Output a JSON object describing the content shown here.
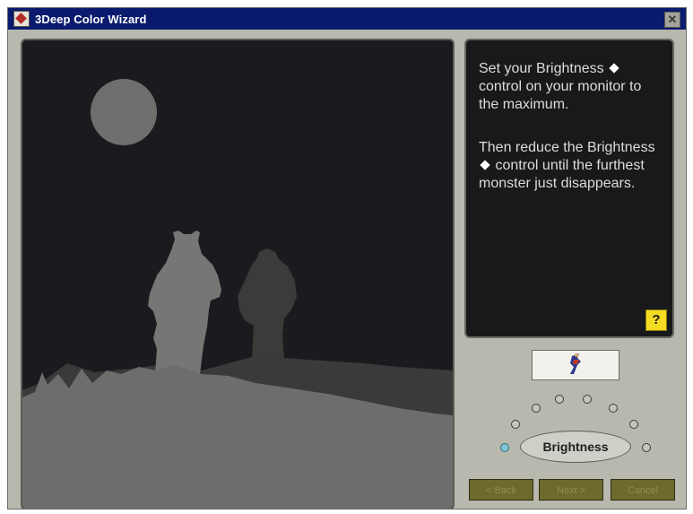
{
  "window": {
    "title": "3Deep Color Wizard",
    "close_glyph": "✕"
  },
  "instructions": {
    "para1_before": "Set your Brightness",
    "para1_after": "control on your monitor to the maximum.",
    "para2_before": "Then reduce the Brightness",
    "para2_after": "control until the furthest monster just disappears.",
    "help_label": "?"
  },
  "control": {
    "label": "Brightness"
  },
  "buttons": {
    "back_label": "< Back",
    "next_label": "Next >",
    "cancel_label": "Cancel"
  },
  "icons": {
    "app": "3deep-logo-icon",
    "close": "close-icon",
    "brightness_symbol": "brightness-symbol-icon",
    "help": "help-icon",
    "preview": "wizard-mascot-icon"
  },
  "colors": {
    "titlebar": "#0a1a6e",
    "scene_bg": "#1a1b1e",
    "silhouette": "#6e6f6d",
    "help_yellow": "#f4dc24",
    "active_knob": "#7ec4d2",
    "button_olive": "#6c6a2c"
  }
}
